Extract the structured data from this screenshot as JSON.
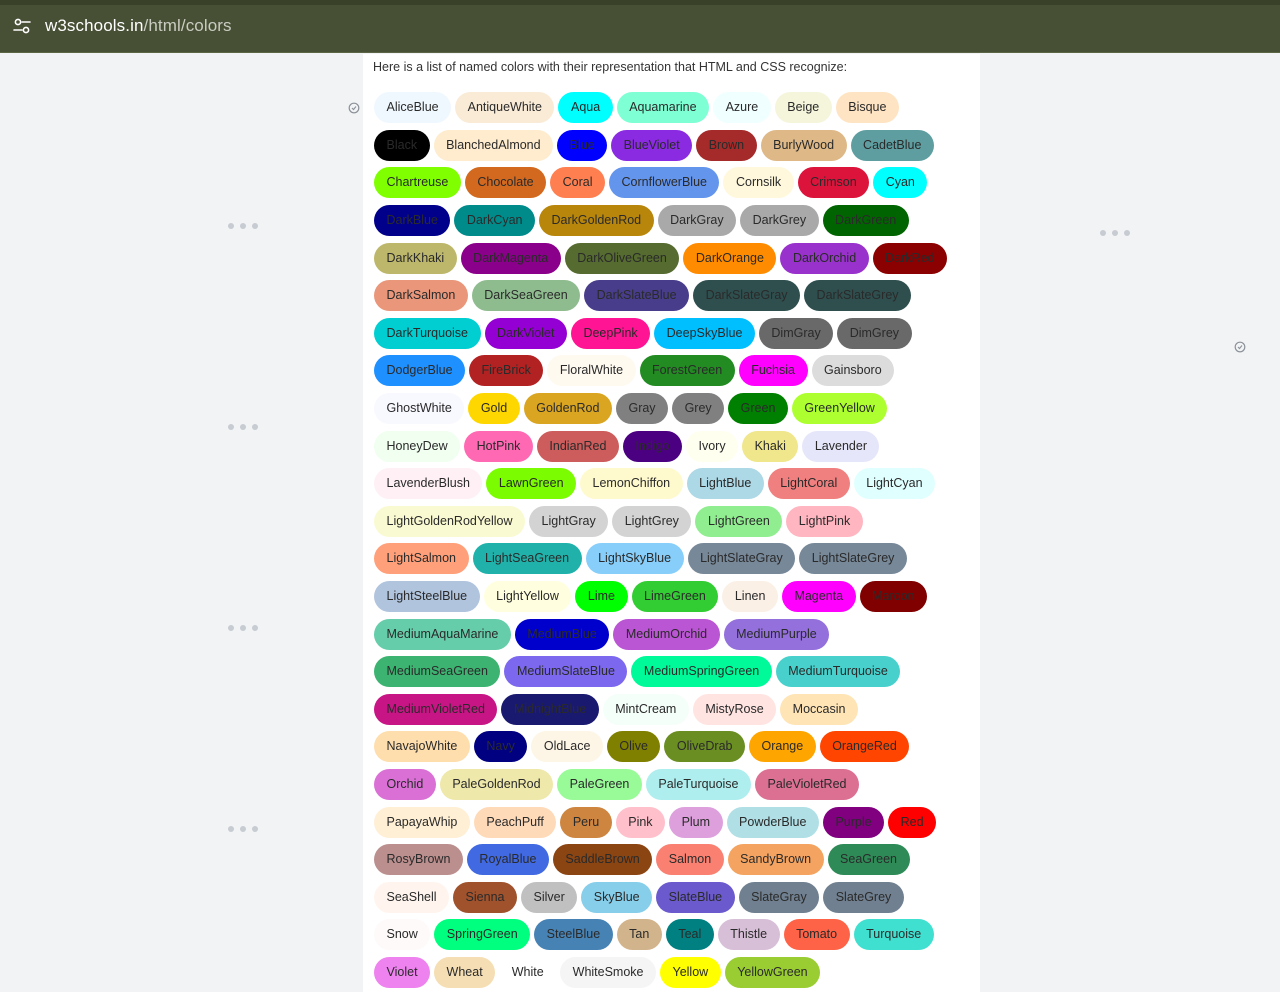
{
  "browser": {
    "domain": "w3schools.in",
    "path": "/html/colors"
  },
  "page": {
    "intro": "Here is a list of named colors with their representation that HTML and CSS recognize:"
  },
  "colors": [
    [
      {
        "name": "AliceBlue",
        "hex": "#F0F8FF"
      },
      {
        "name": "AntiqueWhite",
        "hex": "#FAEBD7"
      },
      {
        "name": "Aqua",
        "hex": "#00FFFF"
      },
      {
        "name": "Aquamarine",
        "hex": "#7FFFD4"
      },
      {
        "name": "Azure",
        "hex": "#F0FFFF"
      },
      {
        "name": "Beige",
        "hex": "#F5F5DC"
      },
      {
        "name": "Bisque",
        "hex": "#FFE4C4"
      }
    ],
    [
      {
        "name": "Black",
        "hex": "#000000"
      },
      {
        "name": "BlanchedAlmond",
        "hex": "#FFEBCD"
      },
      {
        "name": "Blue",
        "hex": "#0000FF"
      },
      {
        "name": "BlueViolet",
        "hex": "#8A2BE2"
      },
      {
        "name": "Brown",
        "hex": "#A52A2A"
      },
      {
        "name": "BurlyWood",
        "hex": "#DEB887"
      },
      {
        "name": "CadetBlue",
        "hex": "#5F9EA0"
      }
    ],
    [
      {
        "name": "Chartreuse",
        "hex": "#7FFF00"
      },
      {
        "name": "Chocolate",
        "hex": "#D2691E"
      },
      {
        "name": "Coral",
        "hex": "#FF7F50"
      },
      {
        "name": "CornflowerBlue",
        "hex": "#6495ED"
      },
      {
        "name": "Cornsilk",
        "hex": "#FFF8DC"
      },
      {
        "name": "Crimson",
        "hex": "#DC143C"
      },
      {
        "name": "Cyan",
        "hex": "#00FFFF"
      }
    ],
    [
      {
        "name": "DarkBlue",
        "hex": "#00008B"
      },
      {
        "name": "DarkCyan",
        "hex": "#008B8B"
      },
      {
        "name": "DarkGoldenRod",
        "hex": "#B8860B"
      },
      {
        "name": "DarkGray",
        "hex": "#A9A9A9"
      },
      {
        "name": "DarkGrey",
        "hex": "#A9A9A9"
      },
      {
        "name": "DarkGreen",
        "hex": "#006400"
      }
    ],
    [
      {
        "name": "DarkKhaki",
        "hex": "#BDB76B"
      },
      {
        "name": "DarkMagenta",
        "hex": "#8B008B"
      },
      {
        "name": "DarkOliveGreen",
        "hex": "#556B2F"
      },
      {
        "name": "DarkOrange",
        "hex": "#FF8C00"
      },
      {
        "name": "DarkOrchid",
        "hex": "#9932CC"
      },
      {
        "name": "DarkRed",
        "hex": "#8B0000"
      }
    ],
    [
      {
        "name": "DarkSalmon",
        "hex": "#E9967A"
      },
      {
        "name": "DarkSeaGreen",
        "hex": "#8FBC8F"
      },
      {
        "name": "DarkSlateBlue",
        "hex": "#483D8B"
      },
      {
        "name": "DarkSlateGray",
        "hex": "#2F4F4F"
      },
      {
        "name": "DarkSlateGrey",
        "hex": "#2F4F4F"
      }
    ],
    [
      {
        "name": "DarkTurquoise",
        "hex": "#00CED1"
      },
      {
        "name": "DarkViolet",
        "hex": "#9400D3"
      },
      {
        "name": "DeepPink",
        "hex": "#FF1493"
      },
      {
        "name": "DeepSkyBlue",
        "hex": "#00BFFF"
      },
      {
        "name": "DimGray",
        "hex": "#696969"
      },
      {
        "name": "DimGrey",
        "hex": "#696969"
      }
    ],
    [
      {
        "name": "DodgerBlue",
        "hex": "#1E90FF"
      },
      {
        "name": "FireBrick",
        "hex": "#B22222"
      },
      {
        "name": "FloralWhite",
        "hex": "#FFFAF0"
      },
      {
        "name": "ForestGreen",
        "hex": "#228B22"
      },
      {
        "name": "Fuchsia",
        "hex": "#FF00FF"
      },
      {
        "name": "Gainsboro",
        "hex": "#DCDCDC"
      }
    ],
    [
      {
        "name": "GhostWhite",
        "hex": "#F8F8FF"
      },
      {
        "name": "Gold",
        "hex": "#FFD700"
      },
      {
        "name": "GoldenRod",
        "hex": "#DAA520"
      },
      {
        "name": "Gray",
        "hex": "#808080"
      },
      {
        "name": "Grey",
        "hex": "#808080"
      },
      {
        "name": "Green",
        "hex": "#008000"
      },
      {
        "name": "GreenYellow",
        "hex": "#ADFF2F"
      }
    ],
    [
      {
        "name": "HoneyDew",
        "hex": "#F0FFF0"
      },
      {
        "name": "HotPink",
        "hex": "#FF69B4"
      },
      {
        "name": "IndianRed",
        "hex": "#CD5C5C"
      },
      {
        "name": "Indigo",
        "hex": "#4B0082"
      },
      {
        "name": "Ivory",
        "hex": "#FFFFF0"
      },
      {
        "name": "Khaki",
        "hex": "#F0E68C"
      },
      {
        "name": "Lavender",
        "hex": "#E6E6FA"
      }
    ],
    [
      {
        "name": "LavenderBlush",
        "hex": "#FFF0F5"
      },
      {
        "name": "LawnGreen",
        "hex": "#7CFC00"
      },
      {
        "name": "LemonChiffon",
        "hex": "#FFFACD"
      },
      {
        "name": "LightBlue",
        "hex": "#ADD8E6"
      },
      {
        "name": "LightCoral",
        "hex": "#F08080"
      },
      {
        "name": "LightCyan",
        "hex": "#E0FFFF"
      }
    ],
    [
      {
        "name": "LightGoldenRodYellow",
        "hex": "#FAFAD2"
      },
      {
        "name": "LightGray",
        "hex": "#D3D3D3"
      },
      {
        "name": "LightGrey",
        "hex": "#D3D3D3"
      },
      {
        "name": "LightGreen",
        "hex": "#90EE90"
      },
      {
        "name": "LightPink",
        "hex": "#FFB6C1"
      }
    ],
    [
      {
        "name": "LightSalmon",
        "hex": "#FFA07A"
      },
      {
        "name": "LightSeaGreen",
        "hex": "#20B2AA"
      },
      {
        "name": "LightSkyBlue",
        "hex": "#87CEFA"
      },
      {
        "name": "LightSlateGray",
        "hex": "#778899"
      },
      {
        "name": "LightSlateGrey",
        "hex": "#778899"
      }
    ],
    [
      {
        "name": "LightSteelBlue",
        "hex": "#B0C4DE"
      },
      {
        "name": "LightYellow",
        "hex": "#FFFFE0"
      },
      {
        "name": "Lime",
        "hex": "#00FF00"
      },
      {
        "name": "LimeGreen",
        "hex": "#32CD32"
      },
      {
        "name": "Linen",
        "hex": "#FAF0E6"
      },
      {
        "name": "Magenta",
        "hex": "#FF00FF"
      },
      {
        "name": "Maroon",
        "hex": "#800000"
      }
    ],
    [
      {
        "name": "MediumAquaMarine",
        "hex": "#66CDAA"
      },
      {
        "name": "MediumBlue",
        "hex": "#0000CD"
      },
      {
        "name": "MediumOrchid",
        "hex": "#BA55D3"
      },
      {
        "name": "MediumPurple",
        "hex": "#9370DB"
      }
    ],
    [
      {
        "name": "MediumSeaGreen",
        "hex": "#3CB371"
      },
      {
        "name": "MediumSlateBlue",
        "hex": "#7B68EE"
      },
      {
        "name": "MediumSpringGreen",
        "hex": "#00FA9A"
      },
      {
        "name": "MediumTurquoise",
        "hex": "#48D1CC"
      }
    ],
    [
      {
        "name": "MediumVioletRed",
        "hex": "#C71585"
      },
      {
        "name": "MidnightBlue",
        "hex": "#191970"
      },
      {
        "name": "MintCream",
        "hex": "#F5FFFA"
      },
      {
        "name": "MistyRose",
        "hex": "#FFE4E1"
      },
      {
        "name": "Moccasin",
        "hex": "#FFE4B5"
      }
    ],
    [
      {
        "name": "NavajoWhite",
        "hex": "#FFDEAD"
      },
      {
        "name": "Navy",
        "hex": "#000080"
      },
      {
        "name": "OldLace",
        "hex": "#FDF5E6"
      },
      {
        "name": "Olive",
        "hex": "#808000"
      },
      {
        "name": "OliveDrab",
        "hex": "#6B8E23"
      },
      {
        "name": "Orange",
        "hex": "#FFA500"
      },
      {
        "name": "OrangeRed",
        "hex": "#FF4500"
      }
    ],
    [
      {
        "name": "Orchid",
        "hex": "#DA70D6"
      },
      {
        "name": "PaleGoldenRod",
        "hex": "#EEE8AA"
      },
      {
        "name": "PaleGreen",
        "hex": "#98FB98"
      },
      {
        "name": "PaleTurquoise",
        "hex": "#AFEEEE"
      },
      {
        "name": "PaleVioletRed",
        "hex": "#DB7093"
      }
    ],
    [
      {
        "name": "PapayaWhip",
        "hex": "#FFEFD5"
      },
      {
        "name": "PeachPuff",
        "hex": "#FFDAB9"
      },
      {
        "name": "Peru",
        "hex": "#CD853F"
      },
      {
        "name": "Pink",
        "hex": "#FFC0CB"
      },
      {
        "name": "Plum",
        "hex": "#DDA0DD"
      },
      {
        "name": "PowderBlue",
        "hex": "#B0E0E6"
      },
      {
        "name": "Purple",
        "hex": "#800080"
      },
      {
        "name": "Red",
        "hex": "#FF0000"
      }
    ],
    [
      {
        "name": "RosyBrown",
        "hex": "#BC8F8F"
      },
      {
        "name": "RoyalBlue",
        "hex": "#4169E1"
      },
      {
        "name": "SaddleBrown",
        "hex": "#8B4513"
      },
      {
        "name": "Salmon",
        "hex": "#FA8072"
      },
      {
        "name": "SandyBrown",
        "hex": "#F4A460"
      },
      {
        "name": "SeaGreen",
        "hex": "#2E8B57"
      }
    ],
    [
      {
        "name": "SeaShell",
        "hex": "#FFF5EE"
      },
      {
        "name": "Sienna",
        "hex": "#A0522D"
      },
      {
        "name": "Silver",
        "hex": "#C0C0C0"
      },
      {
        "name": "SkyBlue",
        "hex": "#87CEEB"
      },
      {
        "name": "SlateBlue",
        "hex": "#6A5ACD"
      },
      {
        "name": "SlateGray",
        "hex": "#708090"
      },
      {
        "name": "SlateGrey",
        "hex": "#708090"
      }
    ],
    [
      {
        "name": "Snow",
        "hex": "#FFFAFA"
      },
      {
        "name": "SpringGreen",
        "hex": "#00FF7F"
      },
      {
        "name": "SteelBlue",
        "hex": "#4682B4"
      },
      {
        "name": "Tan",
        "hex": "#D2B48C"
      },
      {
        "name": "Teal",
        "hex": "#008080"
      },
      {
        "name": "Thistle",
        "hex": "#D8BFD8"
      },
      {
        "name": "Tomato",
        "hex": "#FF6347"
      },
      {
        "name": "Turquoise",
        "hex": "#40E0D0"
      }
    ],
    [
      {
        "name": "Violet",
        "hex": "#EE82EE"
      },
      {
        "name": "Wheat",
        "hex": "#F5DEB3"
      },
      {
        "name": "White",
        "hex": "#FFFFFF"
      },
      {
        "name": "WhiteSmoke",
        "hex": "#F5F5F5"
      },
      {
        "name": "Yellow",
        "hex": "#FFFF00"
      },
      {
        "name": "YellowGreen",
        "hex": "#9ACD32"
      }
    ]
  ]
}
